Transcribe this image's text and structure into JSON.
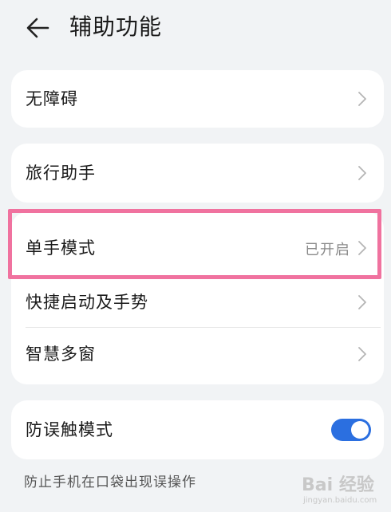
{
  "header": {
    "title": "辅助功能",
    "back_icon": "back-arrow-icon"
  },
  "card1": {
    "item": {
      "label": "无障碍"
    }
  },
  "card2": {
    "item": {
      "label": "旅行助手"
    }
  },
  "card3": {
    "items": [
      {
        "label": "单手模式",
        "value": "已开启"
      },
      {
        "label": "快捷启动及手势"
      },
      {
        "label": "智慧多窗"
      }
    ]
  },
  "card4": {
    "item": {
      "label": "防误触模式",
      "toggle_on": true
    }
  },
  "footnote": "防止手机在口袋出现误操作",
  "watermark": {
    "text": "Bai 经验",
    "sub": "jingyan.baidu.com"
  },
  "colors": {
    "accent": "#2b6fe0",
    "highlight": "#f0729f",
    "background": "#f1f3f5"
  }
}
